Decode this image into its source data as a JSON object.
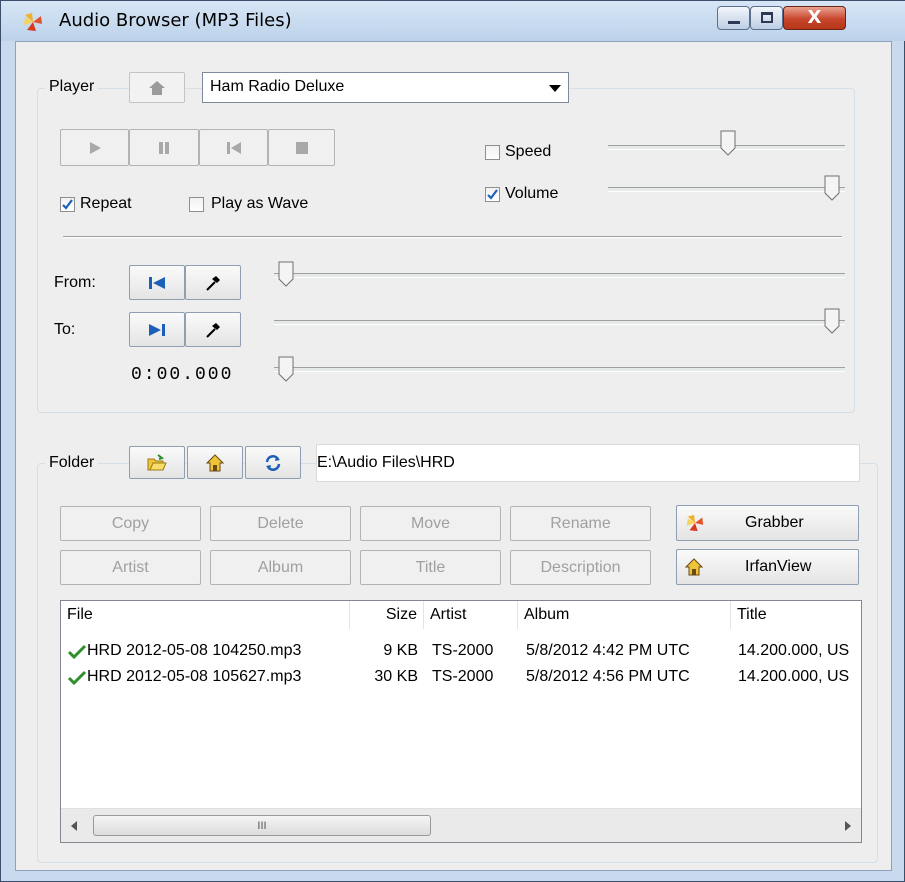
{
  "window": {
    "title": "Audio Browser (MP3 Files)",
    "minimize_glyph": "—",
    "maximize_glyph": "☐",
    "close_glyph": "X"
  },
  "player": {
    "group_label": "Player",
    "selected_player": "Ham Radio Deluxe",
    "repeat_label": "Repeat",
    "repeat_checked": true,
    "play_as_wave_label": "Play as Wave",
    "play_as_wave_checked": false,
    "speed_label": "Speed",
    "speed_checked": false,
    "speed_level": 0.5,
    "volume_label": "Volume",
    "volume_checked": true,
    "volume_level": 1.0,
    "from_label": "From:",
    "to_label": "To:",
    "from_level": 0.0,
    "to_level": 1.0,
    "position_time": "0:00.000",
    "position_level": 0.0
  },
  "folder": {
    "group_label": "Folder",
    "path": "E:\\Audio Files\\HRD",
    "buttons_row1": [
      "Copy",
      "Delete",
      "Move",
      "Rename"
    ],
    "buttons_row2": [
      "Artist",
      "Album",
      "Title",
      "Description"
    ],
    "grabber_label": "Grabber",
    "irfanview_label": "IrfanView"
  },
  "table": {
    "columns": [
      "File",
      "Size",
      "Artist",
      "Album",
      "Title"
    ],
    "rows": [
      {
        "file": "HRD 2012-05-08 104250.mp3",
        "size": "9 KB",
        "artist": "TS-2000",
        "album": "5/8/2012 4:42 PM UTC",
        "title": "14.200.000, US"
      },
      {
        "file": "HRD 2012-05-08 105627.mp3",
        "size": "30 KB",
        "artist": "TS-2000",
        "album": "5/8/2012 4:56 PM UTC",
        "title": "14.200.000, US"
      }
    ],
    "scroll_grip": "III"
  },
  "colors": {
    "accent_blue": "#1c5fb8",
    "check_green": "#2f8f2a",
    "close_red": "#c8452c"
  }
}
